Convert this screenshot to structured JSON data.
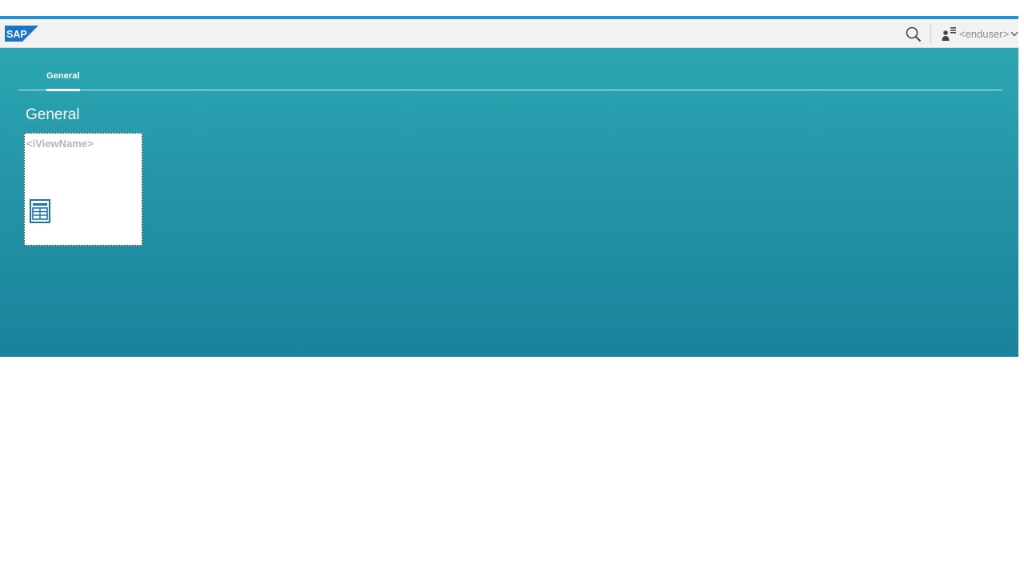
{
  "header": {
    "logo_text": "SAP",
    "search_icon": "search-icon",
    "user_icon": "user-menu-icon",
    "user_name": "<enduser>",
    "chevron_icon": "chevron-down-icon"
  },
  "tabs": [
    {
      "label": "General",
      "selected": true
    }
  ],
  "group": {
    "title": "General",
    "tiles": [
      {
        "title": "<iViewName>",
        "icon": "table-view-icon"
      }
    ]
  },
  "colors": {
    "accent_line": "#2a8fce",
    "header_bg": "#f2f2f2",
    "main_gradient_top": "#2ca7b2",
    "main_gradient_bottom": "#1a829b",
    "tile_icon": "#1f73b7"
  }
}
